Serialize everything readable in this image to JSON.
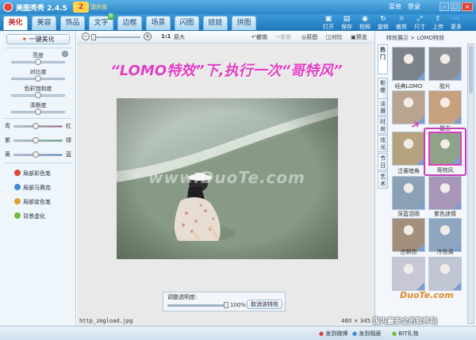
{
  "app": {
    "title": "美图秀秀 2.4.5",
    "version_badge": "2",
    "version_badge_sub": "国庆版"
  },
  "window": {
    "menu": "菜单",
    "login": "登录"
  },
  "tabs": [
    {
      "label": "美化",
      "active": true
    },
    {
      "label": "美容"
    },
    {
      "label": "饰品"
    },
    {
      "label": "文字",
      "badge": "新"
    },
    {
      "label": "边框"
    },
    {
      "label": "场景"
    },
    {
      "label": "闪图"
    },
    {
      "label": "娃娃"
    },
    {
      "label": "拼图"
    }
  ],
  "toolbar_right": [
    {
      "icon": "open-icon",
      "label": "打开"
    },
    {
      "icon": "save-icon",
      "label": "保存"
    },
    {
      "icon": "camera-icon",
      "label": "拍照"
    },
    {
      "icon": "rotate-icon",
      "label": "旋转"
    },
    {
      "icon": "crop-icon",
      "label": "裁剪"
    },
    {
      "icon": "resize-icon",
      "label": "尺寸"
    },
    {
      "icon": "upload-icon",
      "label": "上传"
    },
    {
      "icon": "more-icon",
      "label": "更多"
    }
  ],
  "left": {
    "one_click": "一键美化",
    "sliders": [
      {
        "label": "亮度",
        "value": 0.5
      },
      {
        "label": "对比度",
        "value": 0.5
      },
      {
        "label": "色彩饱和度",
        "value": 0.5
      },
      {
        "label": "清晰度",
        "value": 0.5
      }
    ],
    "color_sliders": [
      {
        "left": "青",
        "right": "红",
        "value": 0.45,
        "color": "#e05050"
      },
      {
        "left": "紫",
        "right": "绿",
        "value": 0.45,
        "color": "#4fb04f"
      },
      {
        "left": "黄",
        "right": "蓝",
        "value": 0.45,
        "color": "#4a7fd6"
      }
    ],
    "tools": [
      {
        "label": "局部彩色笔",
        "color": "#d84a3a"
      },
      {
        "label": "局部马赛克",
        "color": "#3a88d8"
      },
      {
        "label": "局部变色笔",
        "color": "#e0a02a"
      },
      {
        "label": "背景虚化",
        "color": "#6abf3a"
      }
    ]
  },
  "canvas_toolbar": {
    "zoom_ratio": "1:1",
    "original_size": "原大",
    "undo": "撤销",
    "redo": "重做",
    "original": "原图",
    "compare": "对比",
    "hide": "预览"
  },
  "annotation": "“LOMO特效”下,执行一次“哥特风”",
  "watermark": "www.DuoTe.com",
  "opacity": {
    "label": "调整透明度:",
    "value": "100%",
    "level": 1.0,
    "cancel": "取消该特效"
  },
  "status": {
    "filename": "http_imgload.jpg",
    "dims": "460 × 345"
  },
  "right": {
    "header": "特效展示 > LOMO特效",
    "vtabs": [
      "热门",
      "影楼",
      "淡雅",
      "时尚",
      "炫光",
      "节日",
      "艺术"
    ],
    "effects": [
      {
        "label": "经典LOMO",
        "color": "#7c8289"
      },
      {
        "label": "胶片",
        "color": "#8a8f96"
      },
      {
        "label": "",
        "color": "#b9a58f"
      },
      {
        "label": "复古",
        "color": "#c7a07d"
      },
      {
        "label": "泛黄暗角",
        "color": "#b7a27f"
      },
      {
        "label": "哥特风",
        "color": "#8fa389",
        "selected": true
      },
      {
        "label": "深蓝泪雨",
        "color": "#8aa1b8"
      },
      {
        "label": "紫色迷情",
        "color": "#a796b8"
      },
      {
        "label": "古铜色",
        "color": "#a38f7b"
      },
      {
        "label": "冷色调",
        "color": "#8ea6c0"
      },
      {
        "label": "",
        "color": "#c7c7d8"
      },
      {
        "label": "",
        "color": "#c0c6d4"
      }
    ]
  },
  "footer": {
    "share_weibo": "发到微博",
    "share_album": "发到相册",
    "bit_gift": "BIT礼物",
    "corner_text": "国内最安全的软件站",
    "duote": "DuoTe.com"
  }
}
